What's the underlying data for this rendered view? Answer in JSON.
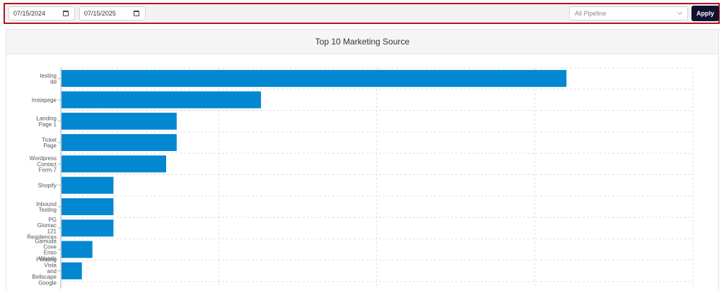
{
  "filters": {
    "start_date": "07/15/2024",
    "end_date": "07/15/2025",
    "pipeline": "All Pipeline",
    "apply_label": "Apply",
    "calendar_icon": "calendar-icon",
    "chevron_icon": "chevron-down-icon"
  },
  "colors": {
    "bar": "#0288d1",
    "apply_button": "#101230",
    "filter_border": "#b3131f"
  },
  "chart_data": {
    "type": "bar",
    "orientation": "horizontal",
    "title": "Top 10 Marketing Source",
    "categories": [
      [
        "testing",
        "dd"
      ],
      [
        "Instapage"
      ],
      [
        "Landing",
        "Page 1"
      ],
      [
        "Ticket",
        "Page"
      ],
      [
        "Wordpress",
        "Contact",
        "Form 7"
      ],
      [
        "Shopify"
      ],
      [
        "Inbound",
        "Testing"
      ],
      [
        "PG",
        "Glomac",
        "121",
        "Residences"
      ],
      [
        "Gamuda",
        "Cove",
        "Enso",
        "Woods"
      ],
      [
        "Petaling",
        "Vista",
        "and",
        "Bellscape",
        "Google"
      ]
    ],
    "values": [
      48,
      19,
      11,
      11,
      10,
      5,
      5,
      5,
      3,
      2
    ],
    "xlim": [
      0,
      60
    ],
    "grid": true,
    "legend": "none"
  }
}
